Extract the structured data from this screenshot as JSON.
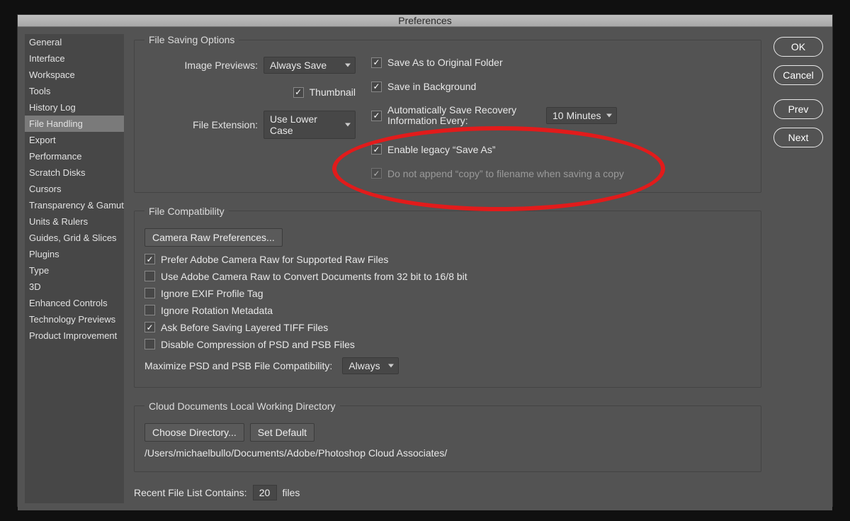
{
  "window": {
    "title": "Preferences"
  },
  "buttons": {
    "ok": "OK",
    "cancel": "Cancel",
    "prev": "Prev",
    "next": "Next"
  },
  "sidebar": {
    "items": [
      "General",
      "Interface",
      "Workspace",
      "Tools",
      "History Log",
      "File Handling",
      "Export",
      "Performance",
      "Scratch Disks",
      "Cursors",
      "Transparency & Gamut",
      "Units & Rulers",
      "Guides, Grid & Slices",
      "Plugins",
      "Type",
      "3D",
      "Enhanced Controls",
      "Technology Previews",
      "Product Improvement"
    ],
    "active_index": 5
  },
  "file_saving": {
    "legend": "File Saving Options",
    "image_previews_label": "Image Previews:",
    "image_previews_value": "Always Save",
    "thumbnail_label": "Thumbnail",
    "file_extension_label": "File Extension:",
    "file_extension_value": "Use Lower Case",
    "save_as_original": "Save As to Original Folder",
    "save_in_background": "Save in Background",
    "auto_save_label": "Automatically Save Recovery Information Every:",
    "auto_save_interval": "10 Minutes",
    "enable_legacy": "Enable legacy “Save As”",
    "no_append_copy": "Do not append “copy” to filename when saving a copy"
  },
  "file_compat": {
    "legend": "File Compatibility",
    "camera_raw_btn": "Camera Raw Preferences...",
    "prefer_raw": "Prefer Adobe Camera Raw for Supported Raw Files",
    "use_raw_32": "Use Adobe Camera Raw to Convert Documents from 32 bit to 16/8 bit",
    "ignore_exif": "Ignore EXIF Profile Tag",
    "ignore_rotation": "Ignore Rotation Metadata",
    "ask_tiff": "Ask Before Saving Layered TIFF Files",
    "disable_compress": "Disable Compression of PSD and PSB Files",
    "maximize_label": "Maximize PSD and PSB File Compatibility:",
    "maximize_value": "Always"
  },
  "cloud": {
    "legend": "Cloud Documents Local Working Directory",
    "choose_btn": "Choose Directory...",
    "default_btn": "Set Default",
    "path": "/Users/michaelbullo/Documents/Adobe/Photoshop Cloud Associates/"
  },
  "recent": {
    "label_before": "Recent File List Contains:",
    "value": "20",
    "label_after": "files"
  }
}
